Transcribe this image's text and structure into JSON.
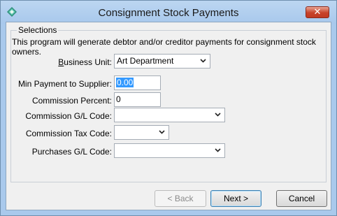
{
  "window": {
    "title": "Consignment Stock Payments",
    "close_glyph": "✕"
  },
  "selections": {
    "title": "Selections",
    "description": "This program will generate debtor and/or creditor payments for consignment stock owners."
  },
  "fields": {
    "business_unit": {
      "label": "Business Unit:",
      "value": "Art Department"
    },
    "min_payment": {
      "label": "Min Payment to Supplier:",
      "value": "0.00"
    },
    "commission_percent": {
      "label": "Commission Percent:",
      "value": "0"
    },
    "commission_gl": {
      "label": "Commission G/L Code:",
      "value": ""
    },
    "commission_tax": {
      "label": "Commission Tax Code:",
      "value": ""
    },
    "purchases_gl": {
      "label": "Purchases G/L Code:",
      "value": ""
    }
  },
  "buttons": {
    "back": "< Back",
    "next": "Next >",
    "cancel": "Cancel"
  },
  "colors": {
    "title_bar": "#a9c9ec",
    "close_button": "#c7432a",
    "selection_highlight": "#3399ff"
  },
  "icons": {
    "app": "diamond-app-icon",
    "dropdown": "chevron-down-icon",
    "close": "close-icon"
  }
}
